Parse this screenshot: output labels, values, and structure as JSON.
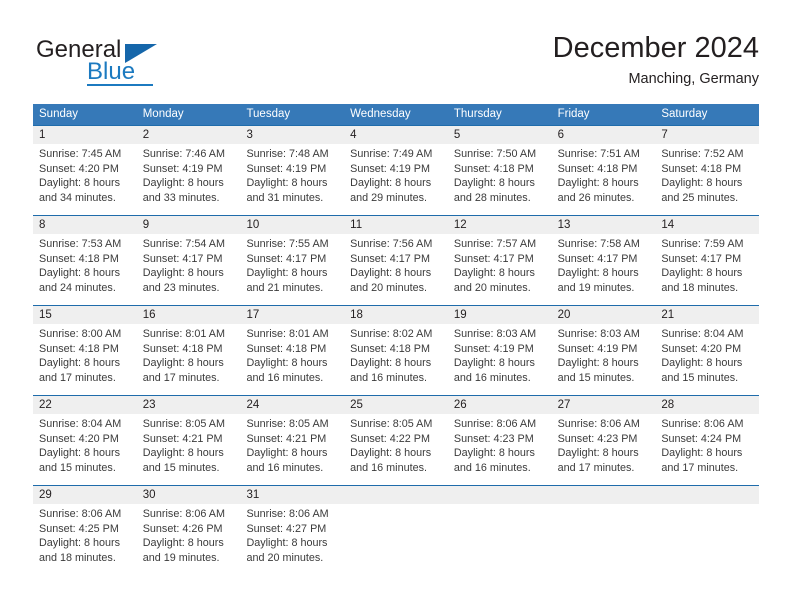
{
  "brand": {
    "name_part1": "General",
    "name_part2": "Blue"
  },
  "header": {
    "title": "December 2024",
    "location": "Manching, Germany"
  },
  "colors": {
    "header_blue": "#3679b8",
    "week_rule_blue": "#1f6cab",
    "daynum_band": "#efefef",
    "brand_blue": "#1c7ac0",
    "text": "#231f20"
  },
  "weekdays": [
    "Sunday",
    "Monday",
    "Tuesday",
    "Wednesday",
    "Thursday",
    "Friday",
    "Saturday"
  ],
  "weeks": [
    {
      "daynums": [
        "1",
        "2",
        "3",
        "4",
        "5",
        "6",
        "7"
      ],
      "cells": [
        {
          "sunrise": "Sunrise: 7:45 AM",
          "sunset": "Sunset: 4:20 PM",
          "daylight1": "Daylight: 8 hours",
          "daylight2": "and 34 minutes."
        },
        {
          "sunrise": "Sunrise: 7:46 AM",
          "sunset": "Sunset: 4:19 PM",
          "daylight1": "Daylight: 8 hours",
          "daylight2": "and 33 minutes."
        },
        {
          "sunrise": "Sunrise: 7:48 AM",
          "sunset": "Sunset: 4:19 PM",
          "daylight1": "Daylight: 8 hours",
          "daylight2": "and 31 minutes."
        },
        {
          "sunrise": "Sunrise: 7:49 AM",
          "sunset": "Sunset: 4:19 PM",
          "daylight1": "Daylight: 8 hours",
          "daylight2": "and 29 minutes."
        },
        {
          "sunrise": "Sunrise: 7:50 AM",
          "sunset": "Sunset: 4:18 PM",
          "daylight1": "Daylight: 8 hours",
          "daylight2": "and 28 minutes."
        },
        {
          "sunrise": "Sunrise: 7:51 AM",
          "sunset": "Sunset: 4:18 PM",
          "daylight1": "Daylight: 8 hours",
          "daylight2": "and 26 minutes."
        },
        {
          "sunrise": "Sunrise: 7:52 AM",
          "sunset": "Sunset: 4:18 PM",
          "daylight1": "Daylight: 8 hours",
          "daylight2": "and 25 minutes."
        }
      ]
    },
    {
      "daynums": [
        "8",
        "9",
        "10",
        "11",
        "12",
        "13",
        "14"
      ],
      "cells": [
        {
          "sunrise": "Sunrise: 7:53 AM",
          "sunset": "Sunset: 4:18 PM",
          "daylight1": "Daylight: 8 hours",
          "daylight2": "and 24 minutes."
        },
        {
          "sunrise": "Sunrise: 7:54 AM",
          "sunset": "Sunset: 4:17 PM",
          "daylight1": "Daylight: 8 hours",
          "daylight2": "and 23 minutes."
        },
        {
          "sunrise": "Sunrise: 7:55 AM",
          "sunset": "Sunset: 4:17 PM",
          "daylight1": "Daylight: 8 hours",
          "daylight2": "and 21 minutes."
        },
        {
          "sunrise": "Sunrise: 7:56 AM",
          "sunset": "Sunset: 4:17 PM",
          "daylight1": "Daylight: 8 hours",
          "daylight2": "and 20 minutes."
        },
        {
          "sunrise": "Sunrise: 7:57 AM",
          "sunset": "Sunset: 4:17 PM",
          "daylight1": "Daylight: 8 hours",
          "daylight2": "and 20 minutes."
        },
        {
          "sunrise": "Sunrise: 7:58 AM",
          "sunset": "Sunset: 4:17 PM",
          "daylight1": "Daylight: 8 hours",
          "daylight2": "and 19 minutes."
        },
        {
          "sunrise": "Sunrise: 7:59 AM",
          "sunset": "Sunset: 4:17 PM",
          "daylight1": "Daylight: 8 hours",
          "daylight2": "and 18 minutes."
        }
      ]
    },
    {
      "daynums": [
        "15",
        "16",
        "17",
        "18",
        "19",
        "20",
        "21"
      ],
      "cells": [
        {
          "sunrise": "Sunrise: 8:00 AM",
          "sunset": "Sunset: 4:18 PM",
          "daylight1": "Daylight: 8 hours",
          "daylight2": "and 17 minutes."
        },
        {
          "sunrise": "Sunrise: 8:01 AM",
          "sunset": "Sunset: 4:18 PM",
          "daylight1": "Daylight: 8 hours",
          "daylight2": "and 17 minutes."
        },
        {
          "sunrise": "Sunrise: 8:01 AM",
          "sunset": "Sunset: 4:18 PM",
          "daylight1": "Daylight: 8 hours",
          "daylight2": "and 16 minutes."
        },
        {
          "sunrise": "Sunrise: 8:02 AM",
          "sunset": "Sunset: 4:18 PM",
          "daylight1": "Daylight: 8 hours",
          "daylight2": "and 16 minutes."
        },
        {
          "sunrise": "Sunrise: 8:03 AM",
          "sunset": "Sunset: 4:19 PM",
          "daylight1": "Daylight: 8 hours",
          "daylight2": "and 16 minutes."
        },
        {
          "sunrise": "Sunrise: 8:03 AM",
          "sunset": "Sunset: 4:19 PM",
          "daylight1": "Daylight: 8 hours",
          "daylight2": "and 15 minutes."
        },
        {
          "sunrise": "Sunrise: 8:04 AM",
          "sunset": "Sunset: 4:20 PM",
          "daylight1": "Daylight: 8 hours",
          "daylight2": "and 15 minutes."
        }
      ]
    },
    {
      "daynums": [
        "22",
        "23",
        "24",
        "25",
        "26",
        "27",
        "28"
      ],
      "cells": [
        {
          "sunrise": "Sunrise: 8:04 AM",
          "sunset": "Sunset: 4:20 PM",
          "daylight1": "Daylight: 8 hours",
          "daylight2": "and 15 minutes."
        },
        {
          "sunrise": "Sunrise: 8:05 AM",
          "sunset": "Sunset: 4:21 PM",
          "daylight1": "Daylight: 8 hours",
          "daylight2": "and 15 minutes."
        },
        {
          "sunrise": "Sunrise: 8:05 AM",
          "sunset": "Sunset: 4:21 PM",
          "daylight1": "Daylight: 8 hours",
          "daylight2": "and 16 minutes."
        },
        {
          "sunrise": "Sunrise: 8:05 AM",
          "sunset": "Sunset: 4:22 PM",
          "daylight1": "Daylight: 8 hours",
          "daylight2": "and 16 minutes."
        },
        {
          "sunrise": "Sunrise: 8:06 AM",
          "sunset": "Sunset: 4:23 PM",
          "daylight1": "Daylight: 8 hours",
          "daylight2": "and 16 minutes."
        },
        {
          "sunrise": "Sunrise: 8:06 AM",
          "sunset": "Sunset: 4:23 PM",
          "daylight1": "Daylight: 8 hours",
          "daylight2": "and 17 minutes."
        },
        {
          "sunrise": "Sunrise: 8:06 AM",
          "sunset": "Sunset: 4:24 PM",
          "daylight1": "Daylight: 8 hours",
          "daylight2": "and 17 minutes."
        }
      ]
    },
    {
      "daynums": [
        "29",
        "30",
        "31",
        "",
        "",
        "",
        ""
      ],
      "cells": [
        {
          "sunrise": "Sunrise: 8:06 AM",
          "sunset": "Sunset: 4:25 PM",
          "daylight1": "Daylight: 8 hours",
          "daylight2": "and 18 minutes."
        },
        {
          "sunrise": "Sunrise: 8:06 AM",
          "sunset": "Sunset: 4:26 PM",
          "daylight1": "Daylight: 8 hours",
          "daylight2": "and 19 minutes."
        },
        {
          "sunrise": "Sunrise: 8:06 AM",
          "sunset": "Sunset: 4:27 PM",
          "daylight1": "Daylight: 8 hours",
          "daylight2": "and 20 minutes."
        },
        {
          "sunrise": "",
          "sunset": "",
          "daylight1": "",
          "daylight2": ""
        },
        {
          "sunrise": "",
          "sunset": "",
          "daylight1": "",
          "daylight2": ""
        },
        {
          "sunrise": "",
          "sunset": "",
          "daylight1": "",
          "daylight2": ""
        },
        {
          "sunrise": "",
          "sunset": "",
          "daylight1": "",
          "daylight2": ""
        }
      ]
    }
  ]
}
